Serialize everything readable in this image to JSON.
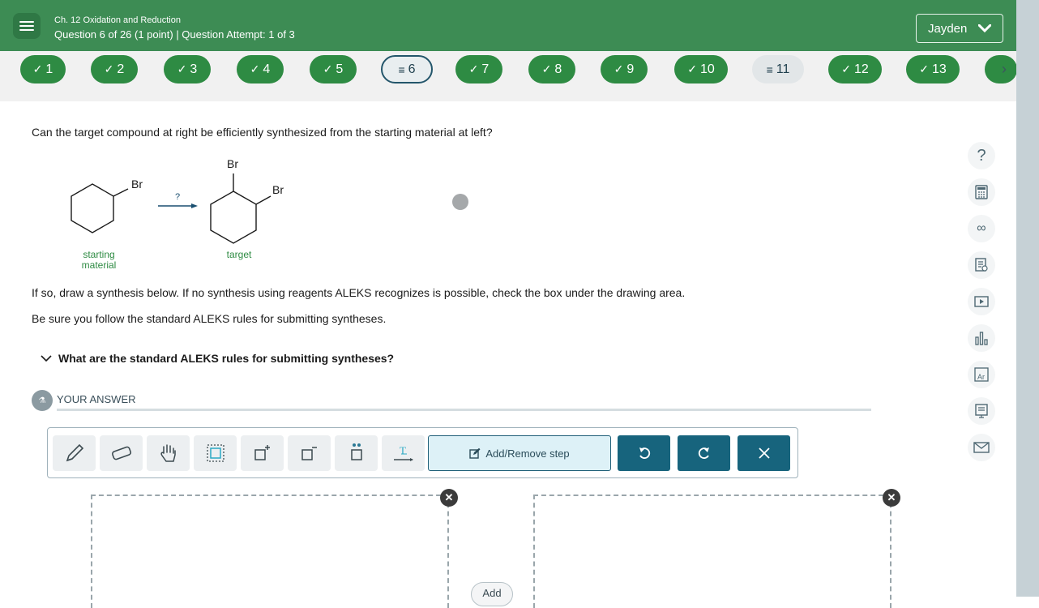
{
  "header": {
    "chapter": "Ch. 12 Oxidation and Reduction",
    "question_info": "Question 6 of 26 (1 point)  |  Question Attempt: 1 of 3",
    "user_name": "Jayden"
  },
  "questions": [
    {
      "number": "1",
      "status": "done"
    },
    {
      "number": "2",
      "status": "done"
    },
    {
      "number": "3",
      "status": "done"
    },
    {
      "number": "4",
      "status": "done"
    },
    {
      "number": "5",
      "status": "done"
    },
    {
      "number": "6",
      "status": "current"
    },
    {
      "number": "7",
      "status": "done"
    },
    {
      "number": "8",
      "status": "done"
    },
    {
      "number": "9",
      "status": "done"
    },
    {
      "number": "10",
      "status": "done"
    },
    {
      "number": "11",
      "status": "pending"
    },
    {
      "number": "12",
      "status": "done"
    },
    {
      "number": "13",
      "status": "done"
    }
  ],
  "icons": {
    "done": "check-icon",
    "pending": "equals-icon",
    "next": "chevron-right-icon",
    "menu": "hamburger-icon"
  },
  "question": {
    "prompt": "Can the target compound at right be efficiently synthesized from the starting material at left?",
    "arrow_label": "?",
    "starting_substituent": "Br",
    "target_substituent_1": "Br",
    "target_substituent_2": "Br",
    "starting_label_line1": "starting",
    "starting_label_line2": "material",
    "target_label": "target",
    "instruction_1": "If so, draw a synthesis below. If no synthesis using reagents ALEKS recognizes is possible, check the box under the drawing area.",
    "instruction_2": "Be sure you follow the standard ALEKS rules for submitting syntheses.",
    "rules_toggle": "What are the standard ALEKS rules for submitting syntheses?"
  },
  "answer": {
    "section_title": "YOUR ANSWER",
    "add_remove_step": "Add/Remove step",
    "add_label": "Add"
  },
  "tools": [
    "pencil-tool",
    "eraser-tool",
    "hand-tool",
    "select-tool",
    "increase-charge-tool",
    "decrease-charge-tool",
    "lone-pair-tool",
    "text-arrow-tool"
  ],
  "side_tools": [
    "help-icon",
    "calculator-icon",
    "infinity-icon",
    "notes-icon",
    "video-icon",
    "chart-icon",
    "periodic-table-icon",
    "whiteboard-icon",
    "mail-icon"
  ],
  "colors": {
    "header_green": "#3d8c54",
    "pill_green": "#2e8b43",
    "dark_teal": "#17647d",
    "label_green": "#2e8b43"
  }
}
